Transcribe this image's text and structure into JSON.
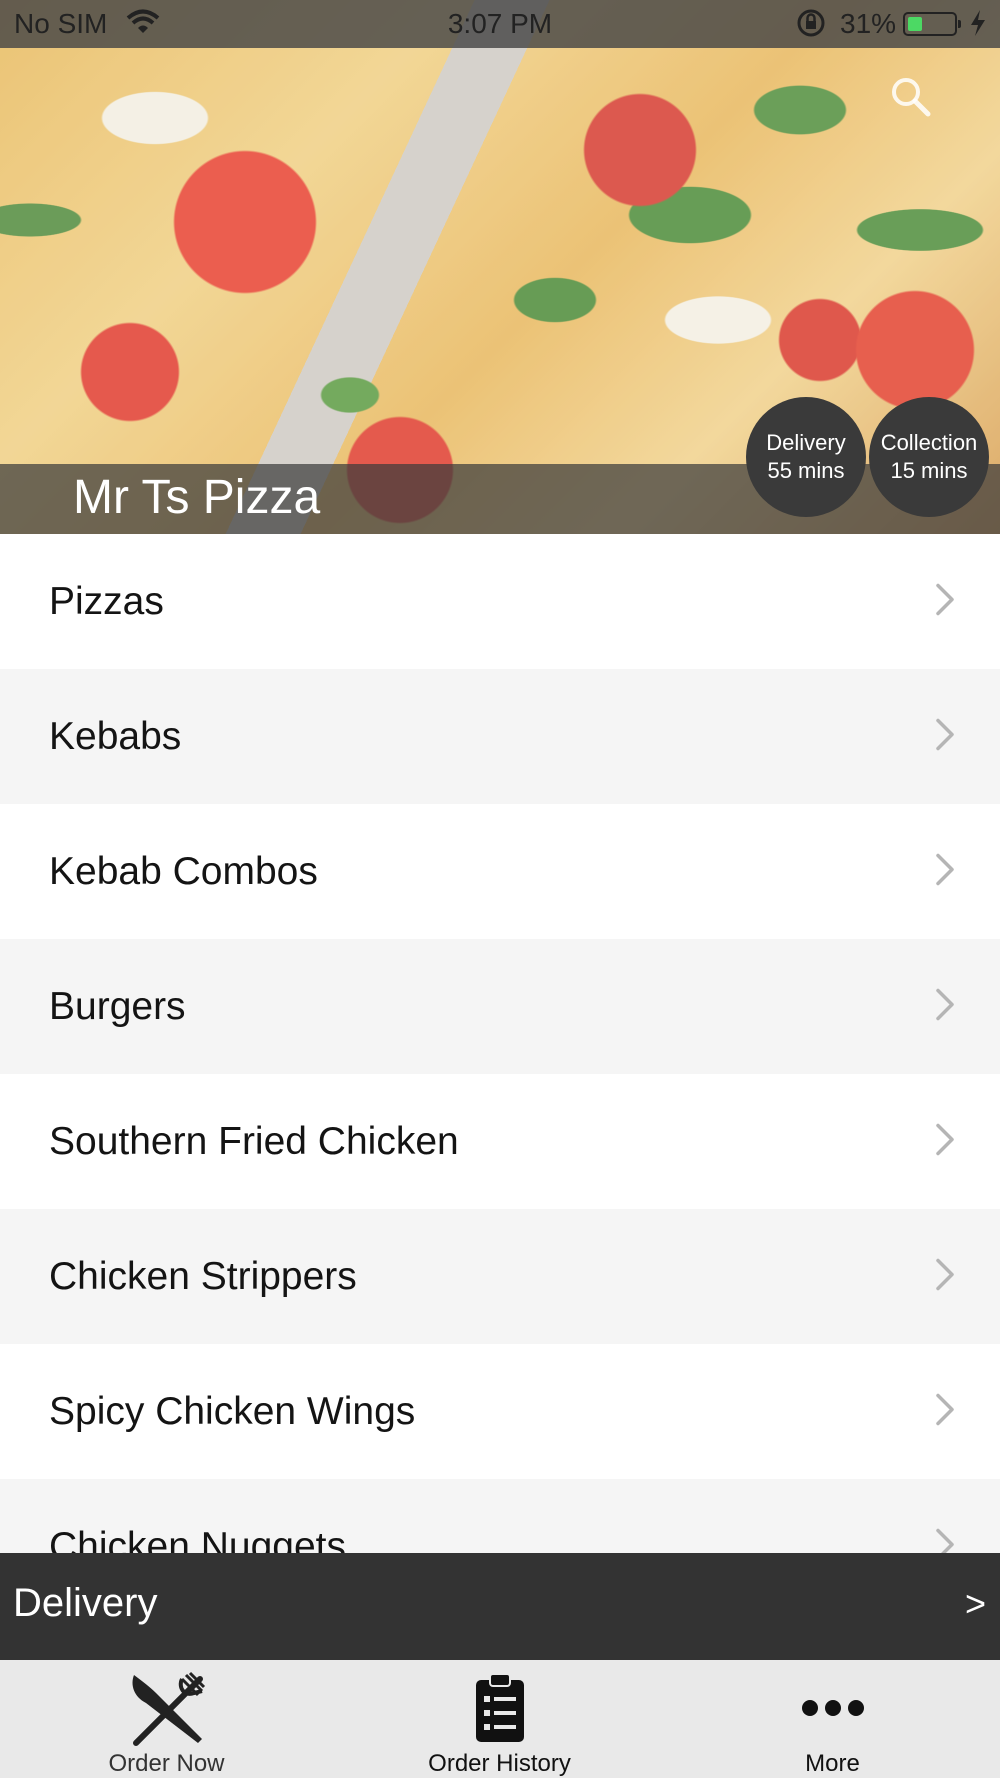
{
  "status_bar": {
    "carrier": "No SIM",
    "time": "3:07 PM",
    "battery_percent": "31%",
    "battery_level": 0.31
  },
  "hero": {
    "restaurant_name": "Mr Ts Pizza",
    "delivery": {
      "label": "Delivery",
      "time": "55 mins"
    },
    "collection": {
      "label": "Collection",
      "time": "15 mins"
    }
  },
  "menu": {
    "items": [
      {
        "label": "Pizzas"
      },
      {
        "label": "Kebabs"
      },
      {
        "label": "Kebab Combos"
      },
      {
        "label": "Burgers"
      },
      {
        "label": "Southern Fried Chicken"
      },
      {
        "label": "Chicken Strippers"
      },
      {
        "label": "Spicy Chicken Wings"
      },
      {
        "label": "Chicken Nuggets"
      }
    ]
  },
  "delivery_bar": {
    "label": "Delivery",
    "arrow": ">"
  },
  "tab_bar": {
    "tabs": [
      {
        "label": "Order Now",
        "icon": "fork-knife-icon"
      },
      {
        "label": "Order History",
        "icon": "clipboard-list-icon"
      },
      {
        "label": "More",
        "icon": "more-dots-icon"
      }
    ]
  },
  "colors": {
    "dark_bar": "#333333",
    "badge": "#3a3a3a",
    "row_alt": "#f5f5f5",
    "tab_bar": "#e9e9e9",
    "battery": "#4cd964"
  }
}
